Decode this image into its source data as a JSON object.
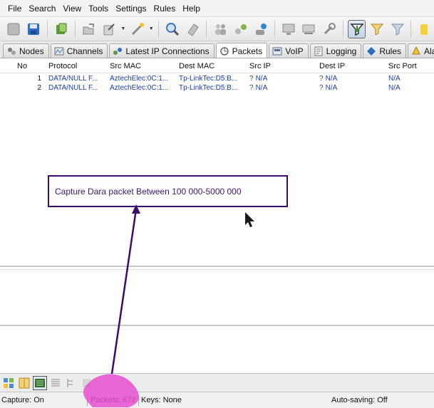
{
  "menu": [
    "File",
    "Search",
    "View",
    "Tools",
    "Settings",
    "Rules",
    "Help"
  ],
  "tabs": [
    {
      "label": "Nodes",
      "icon": "nodes-icon"
    },
    {
      "label": "Channels",
      "icon": "channels-icon"
    },
    {
      "label": "Latest IP Connections",
      "icon": "ip-connections-icon"
    },
    {
      "label": "Packets",
      "icon": "packets-icon",
      "selected": true
    },
    {
      "label": "VoIP",
      "icon": "voip-icon"
    },
    {
      "label": "Logging",
      "icon": "logging-icon"
    },
    {
      "label": "Rules",
      "icon": "rules-icon"
    },
    {
      "label": "Alarm",
      "icon": "alarm-icon"
    }
  ],
  "grid": {
    "columns": [
      "No",
      "Protocol",
      "Src MAC",
      "Dest MAC",
      "Src IP",
      "Dest IP",
      "Src Port"
    ],
    "rows": [
      {
        "no": "1",
        "protocol": "DATA/NULL F...",
        "src_mac": "AztechElec:0C:1...",
        "dest_mac": "Tp-LinkTec:D5:B...",
        "src_ip_q": "?",
        "src_ip": "N/A",
        "dest_ip_q": "?",
        "dest_ip": "N/A",
        "src_port": "N/A"
      },
      {
        "no": "2",
        "protocol": "DATA/NULL F...",
        "src_mac": "AztechElec:0C:1...",
        "dest_mac": "Tp-LinkTec:D5:B...",
        "src_ip_q": "?",
        "src_ip": "N/A",
        "dest_ip_q": "?",
        "dest_ip": "N/A",
        "src_port": "N/A"
      }
    ]
  },
  "callout": {
    "text": "Capture Dara packet Between 100 000-5000 000"
  },
  "status": {
    "capture": "Capture: On",
    "packets": "Packets: 672",
    "keys": "Keys: None",
    "autosave": "Auto-saving: Off"
  },
  "colors": {
    "callout_border": "#3d0b6e",
    "arrow": "#3d0b6e",
    "highlight": "#e84fd0",
    "cell_text": "#1a3bb0"
  }
}
